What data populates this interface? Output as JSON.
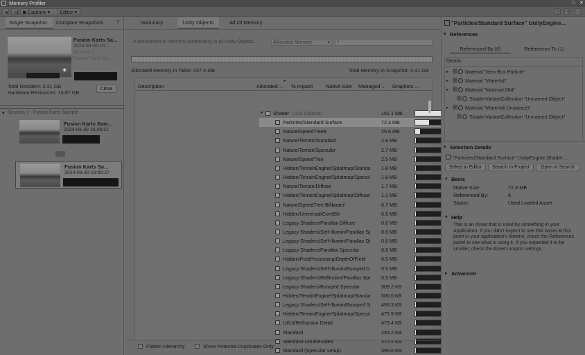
{
  "window": {
    "title": "Memory Profiler"
  },
  "toolbar": {
    "capture": "Capture",
    "editor": "Editor"
  },
  "left": {
    "tabs": [
      "Single Snapshot",
      "Compare Snapshots"
    ],
    "snapshot": {
      "title": "Fusion Karts Sa...",
      "date": "2024-03-30 16:...",
      "session": "Session 1",
      "project": "Fusion Karts Sa..."
    },
    "total_resident": "Total Resident: 3.31 GB",
    "hardware": "Hardware Resources: 15.87 GB",
    "close": "Close",
    "session_header": "Session 1 - Fusion Karts Sample",
    "items": [
      {
        "title": "Fusion Karts Sam...",
        "date": "2024-03-30 16:49:21"
      },
      {
        "title": "Fusion Karts Sa...",
        "date": "2024-03-30 16:55:27"
      }
    ]
  },
  "mid": {
    "tabs": [
      "Summary",
      "Unity Objects",
      "All Of Memory"
    ],
    "breakdown": "A breakdown of memory contributing to all Unity Objects.",
    "dropdown": "Allocated Memory",
    "alloc_table": "Allocated Memory In Table: 437.4 MB",
    "total_snapshot": "Total Memory In Snapshot: 4.41 GB",
    "headers": [
      "Description",
      "Allocated ...",
      "% Impact",
      "Native Size",
      "Managed ...",
      "Graphics ..."
    ],
    "rows": [
      {
        "d": "Shader",
        "extra": "(320 Objects)",
        "a": "151.1 MB",
        "p": 0.35,
        "n": "151.1 MB",
        "m": "1.1 KB",
        "g": "0 B",
        "group": true
      },
      {
        "d": "Particles/Standard Surface",
        "a": "72.3 MB",
        "p": 0.17,
        "n": "72.3 MB",
        "m": "0 B",
        "g": "0 B",
        "sel": true
      },
      {
        "d": "Nature/SpeedTree8",
        "a": "25.6 MB",
        "p": 0.06,
        "n": "25.6 MB",
        "m": "0 B",
        "g": "0 B"
      },
      {
        "d": "Nature/Terrain/Standard",
        "a": "2.8 MB",
        "p": 0.01,
        "n": "2.8 MB",
        "m": "0 B",
        "g": "0 B"
      },
      {
        "d": "Nature/Terrain/Specular",
        "a": "2.7 MB",
        "p": 0.01,
        "n": "2.7 MB",
        "m": "0 B",
        "g": "0 B"
      },
      {
        "d": "Nature/SpeedTree",
        "a": "2.5 MB",
        "p": 0.01,
        "n": "2.5 MB",
        "m": "0 B",
        "g": "0 B"
      },
      {
        "d": "Hidden/TerrainEngine/Splatmap/Standard",
        "a": "1.8 MB",
        "p": 0.004,
        "n": "1.8 MB",
        "m": "0 B",
        "g": "0 B"
      },
      {
        "d": "Hidden/TerrainEngine/Splatmap/Specular",
        "a": "1.8 MB",
        "p": 0.004,
        "n": "1.8 MB",
        "m": "0 B",
        "g": "0 B"
      },
      {
        "d": "Nature/Terrain/Diffuse",
        "a": "1.7 MB",
        "p": 0.004,
        "n": "1.7 MB",
        "m": "0 B",
        "g": "0 B"
      },
      {
        "d": "Hidden/TerrainEngine/Splatmap/Diffuse-A",
        "a": "1.1 MB",
        "p": 0.003,
        "n": "1.1 MB",
        "m": "0 B",
        "g": "0 B"
      },
      {
        "d": "Nature/SpeedTree Billboard",
        "a": "0.7 MB",
        "p": 0.002,
        "n": "0.7 MB",
        "m": "0 B",
        "g": "0 B"
      },
      {
        "d": "Hidden/Universal/CoreBlit",
        "a": "0.6 MB",
        "p": 0.001,
        "n": "0.6 MB",
        "m": "0 B",
        "g": "0 B"
      },
      {
        "d": "Legacy Shaders/Parallax Diffuse",
        "a": "0.6 MB",
        "p": 0.001,
        "n": "0.6 MB",
        "m": "0 B",
        "g": "0 B"
      },
      {
        "d": "Legacy Shaders/Self-Illumin/Parallax Spe",
        "a": "0.6 MB",
        "p": 0.001,
        "n": "0.6 MB",
        "m": "0 B",
        "g": "0 B"
      },
      {
        "d": "Legacy Shaders/Self-Illumin/Parallax Diffu",
        "a": "0.6 MB",
        "p": 0.001,
        "n": "0.6 MB",
        "m": "0 B",
        "g": "0 B"
      },
      {
        "d": "Legacy Shaders/Parallax Specular",
        "a": "0.6 MB",
        "p": 0.001,
        "n": "0.6 MB",
        "m": "0 B",
        "g": "0 B"
      },
      {
        "d": "Hidden/PostProcessing/DepthOfField",
        "a": "0.5 MB",
        "p": 0.001,
        "n": "0.5 MB",
        "m": "40 B",
        "g": "0 B"
      },
      {
        "d": "Legacy Shaders/Self-Illumin/Bumped Diffu",
        "a": "0.5 MB",
        "p": 0.001,
        "n": "0.5 MB",
        "m": "0 B",
        "g": "0 B"
      },
      {
        "d": "Legacy Shaders/Reflective/Parallax Spec",
        "a": "0.5 MB",
        "p": 0.001,
        "n": "0.5 MB",
        "m": "0 B",
        "g": "0 B"
      },
      {
        "d": "Legacy Shaders/Bumped Specular",
        "a": "509.2 KB",
        "p": 0.001,
        "n": "509.2 KB",
        "m": "0 B",
        "g": "0 B"
      },
      {
        "d": "Hidden/TerrainEngine/Splatmap/Standard",
        "a": "500.0 KB",
        "p": 0.001,
        "n": "500.0 KB",
        "m": "0 B",
        "g": "0 B"
      },
      {
        "d": "Legacy Shaders/Self-Illumin/Bumped Spec",
        "a": "493.3 KB",
        "p": 0.001,
        "n": "493.3 KB",
        "m": "0 B",
        "g": "0 B"
      },
      {
        "d": "Hidden/TerrainEngine/Splatmap/Specular",
        "a": "475.9 KB",
        "p": 0.001,
        "n": "475.9 KB",
        "m": "0 B",
        "g": "0 B"
      },
      {
        "d": "UI/Lit/Refraction Detail",
        "a": "475.4 KB",
        "p": 0.001,
        "n": "475.4 KB",
        "m": "0 B",
        "g": "0 B"
      },
      {
        "d": "Standard",
        "a": "445.2 KB",
        "p": 0.001,
        "n": "445.2 KB",
        "m": "0 B",
        "g": "0 B"
      },
      {
        "d": "Standard-DoubleSided",
        "a": "415.5 KB",
        "p": 0.001,
        "n": "415.5 KB",
        "m": "0 B",
        "g": "0 B"
      },
      {
        "d": "Standard (Specular setup)",
        "a": "390.6 KB",
        "p": 0.001,
        "n": "390.6 KB",
        "m": "0 B",
        "g": "0 B"
      }
    ],
    "flatten": "Flatten Hierarchy",
    "duplicates": "Show Potential Duplicates Only"
  },
  "right": {
    "title": "\"Particles/Standard Surface\" UnityEngine...",
    "references": "References",
    "ref_tabs": [
      "Referenced By (6)",
      "References To (1)"
    ],
    "details": "Details",
    "refs": [
      "Material \"Item Box Particle\"",
      "Material \"Waterfall\"",
      "Material \"Material.004\"",
      "ShaderVariantCollection \"Unnamed Object\"",
      "Material \"Waterfall (Instance)\"",
      "ShaderVariantCollection \"Unnamed Object\""
    ],
    "sel_details": "Selection Details",
    "sel_name": "\"Particles/Standard Surface\" UnityEngine.Shader ...",
    "buttons": [
      "Select in Editor",
      "Search In Project",
      "Open in Search"
    ],
    "basic": "Basic",
    "fields": [
      {
        "k": "Native Size:",
        "v": "72.3 MB"
      },
      {
        "k": "Referenced By:",
        "v": "6"
      },
      {
        "k": "Status:",
        "v": "Used Loaded Asset"
      }
    ],
    "help": "Help",
    "help_text": "This is an Asset that is used by something in your Application. If you didn't expect to see this Asset at this point in your application's lifetime, check the References panel to see what is using it. If you expected it to be smaller, check the Asset's import settings.",
    "advanced": "Advanced"
  }
}
